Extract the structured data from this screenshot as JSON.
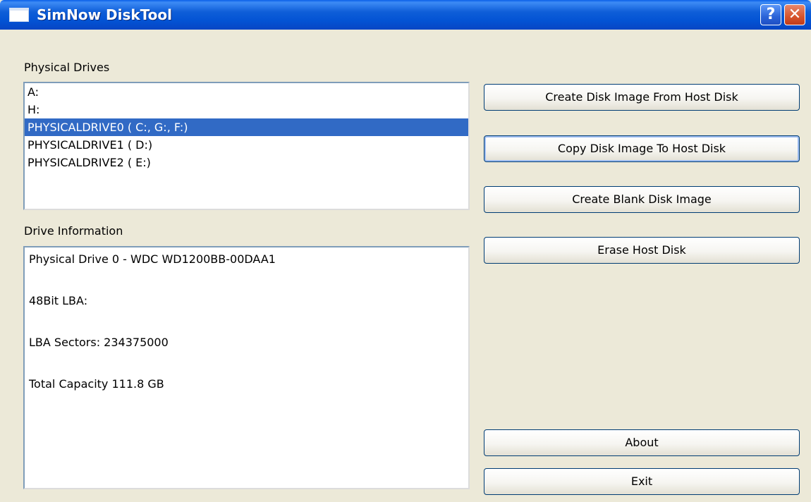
{
  "window": {
    "title": "SimNow DiskTool",
    "help_glyph": "?",
    "close_glyph": "✕"
  },
  "physical_drives": {
    "label": "Physical Drives",
    "items": [
      {
        "label": "A:",
        "selected": false
      },
      {
        "label": "H:",
        "selected": false
      },
      {
        "label": "PHYSICALDRIVE0 ( C:, G:, F:)",
        "selected": true
      },
      {
        "label": "PHYSICALDRIVE1 ( D:)",
        "selected": false
      },
      {
        "label": "PHYSICALDRIVE2 ( E:)",
        "selected": false
      }
    ]
  },
  "drive_information": {
    "label": "Drive Information",
    "lines": [
      "Physical Drive 0 - WDC WD1200BB-00DAA1",
      "48Bit LBA:",
      "LBA Sectors: 234375000",
      "Total Capacity 111.8 GB"
    ]
  },
  "buttons": {
    "create_image": "Create Disk Image From Host Disk",
    "copy_image": "Copy Disk Image To Host Disk",
    "create_blank": "Create Blank Disk Image",
    "erase_disk": "Erase Host Disk",
    "about": "About",
    "exit": "Exit"
  },
  "icons": {
    "app": "window-icon",
    "help": "help-icon",
    "close": "close-icon"
  },
  "colors": {
    "title_bar": "#0353d4",
    "selection": "#316ac5",
    "window_bg": "#ece9d8",
    "close_button": "#d7542c"
  }
}
